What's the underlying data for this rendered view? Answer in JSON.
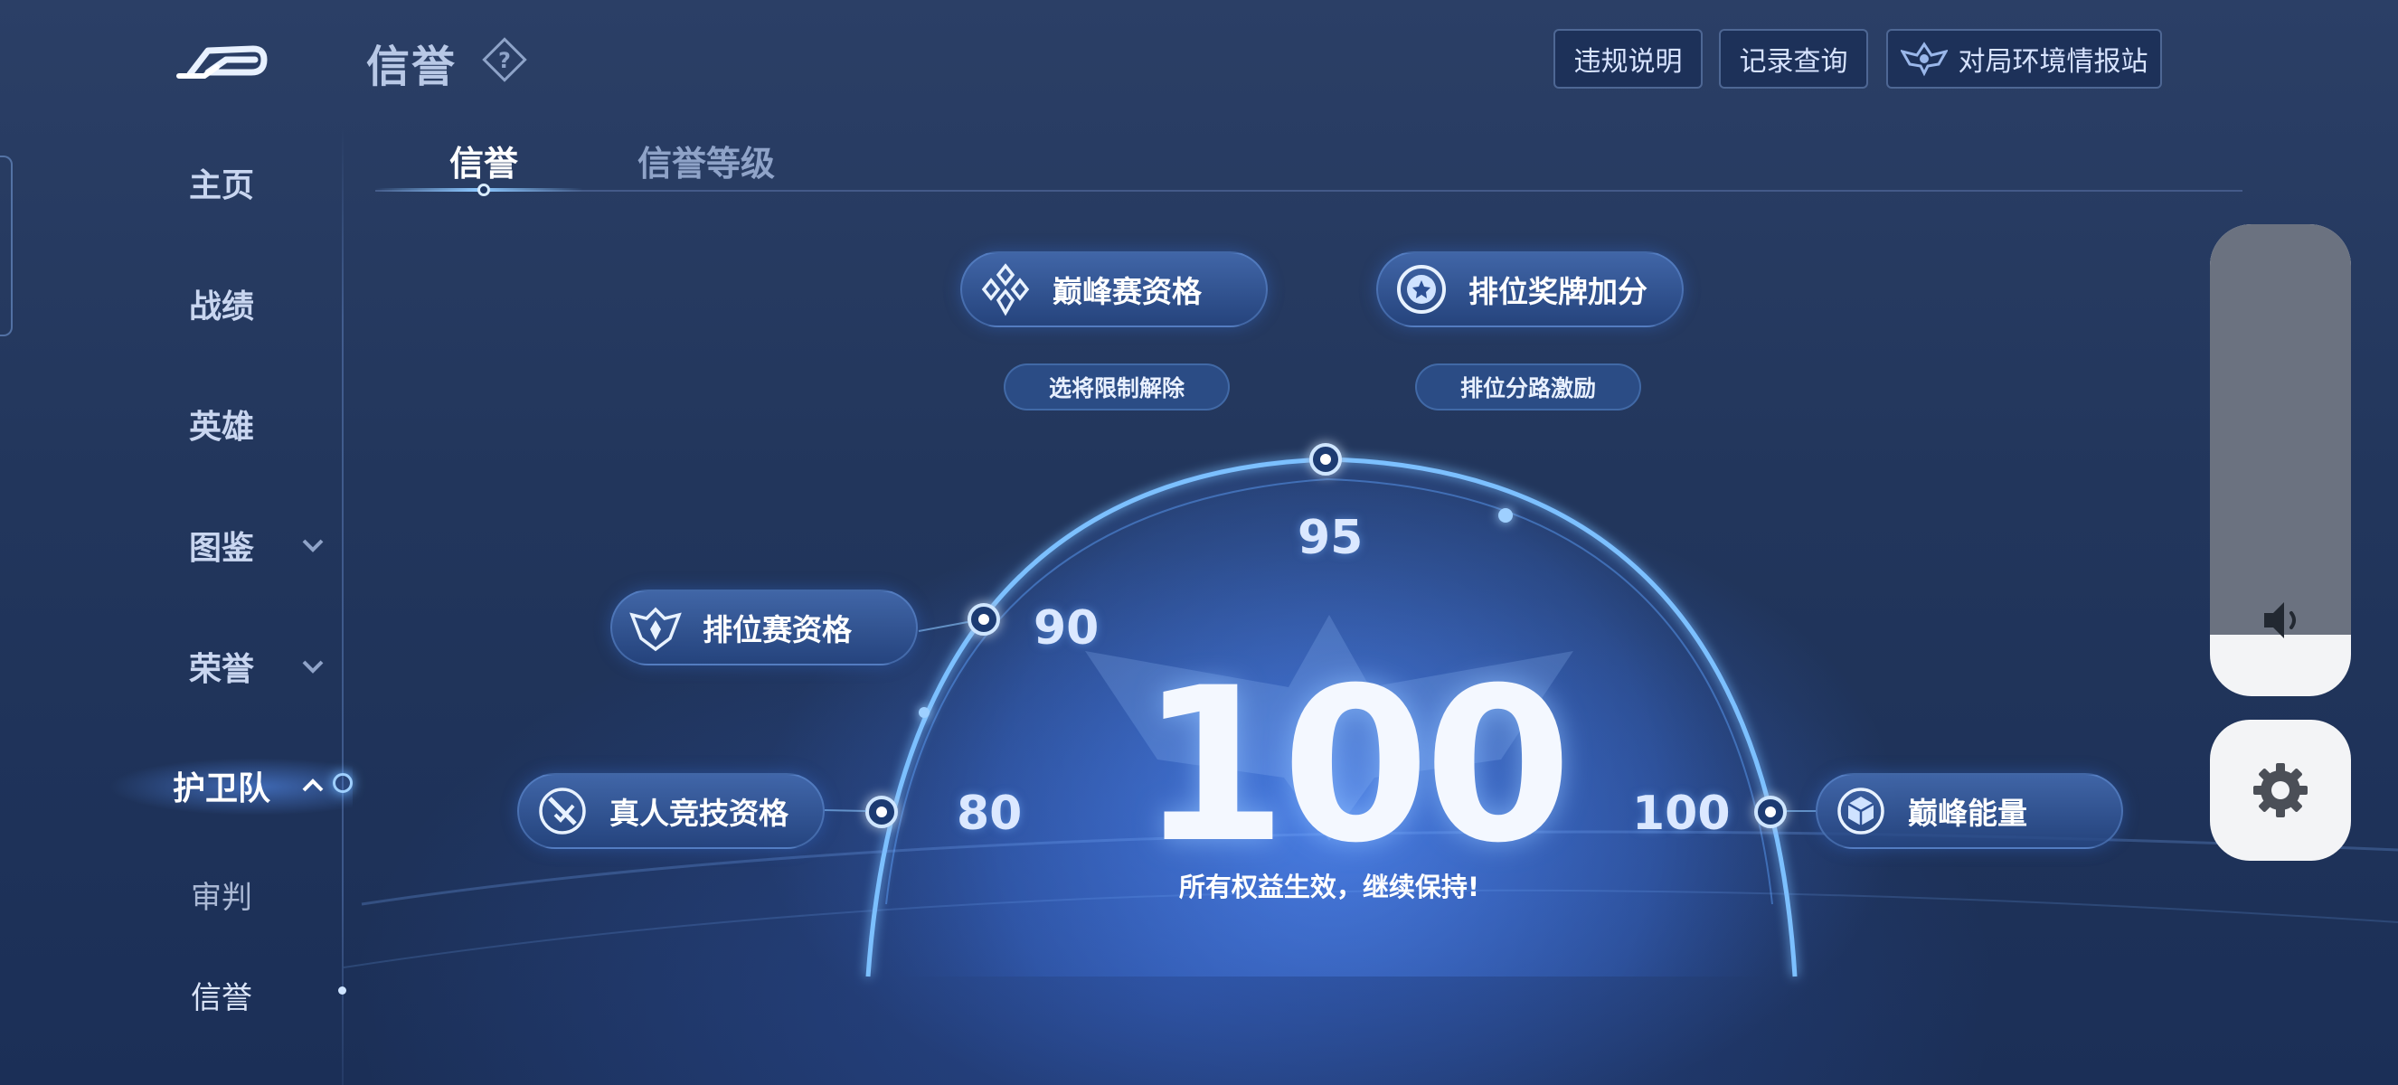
{
  "header": {
    "title": "信誉",
    "buttons": {
      "violation": "违规说明",
      "records": "记录查询",
      "station": "对局环境情报站"
    }
  },
  "sidebar": {
    "items": [
      {
        "label": "主页"
      },
      {
        "label": "战绩"
      },
      {
        "label": "英雄"
      },
      {
        "label": "图鉴"
      },
      {
        "label": "荣誉"
      },
      {
        "label": "护卫队"
      },
      {
        "label": "审判"
      },
      {
        "label": "信誉"
      }
    ]
  },
  "tabs": [
    {
      "label": "信誉",
      "active": true
    },
    {
      "label": "信誉等级",
      "active": false
    }
  ],
  "credit": {
    "score": "100",
    "message": "所有权益生效，继续保持!",
    "score_value": 100,
    "tiers": [
      "80",
      "90",
      "95",
      "100"
    ],
    "benefits": {
      "peak": "巅峰赛资格",
      "medal": "排位奖牌加分",
      "ranked": "排位赛资格",
      "real": "真人竞技资格",
      "energy": "巅峰能量"
    },
    "sub_benefits": {
      "unlock": "选将限制解除",
      "lane": "排位分路激励"
    }
  },
  "controls": {
    "volume_level": 0.13
  },
  "colors": {
    "accent": "#8cc8ff",
    "background": "#22365c",
    "panel": "#f3f4f6"
  }
}
